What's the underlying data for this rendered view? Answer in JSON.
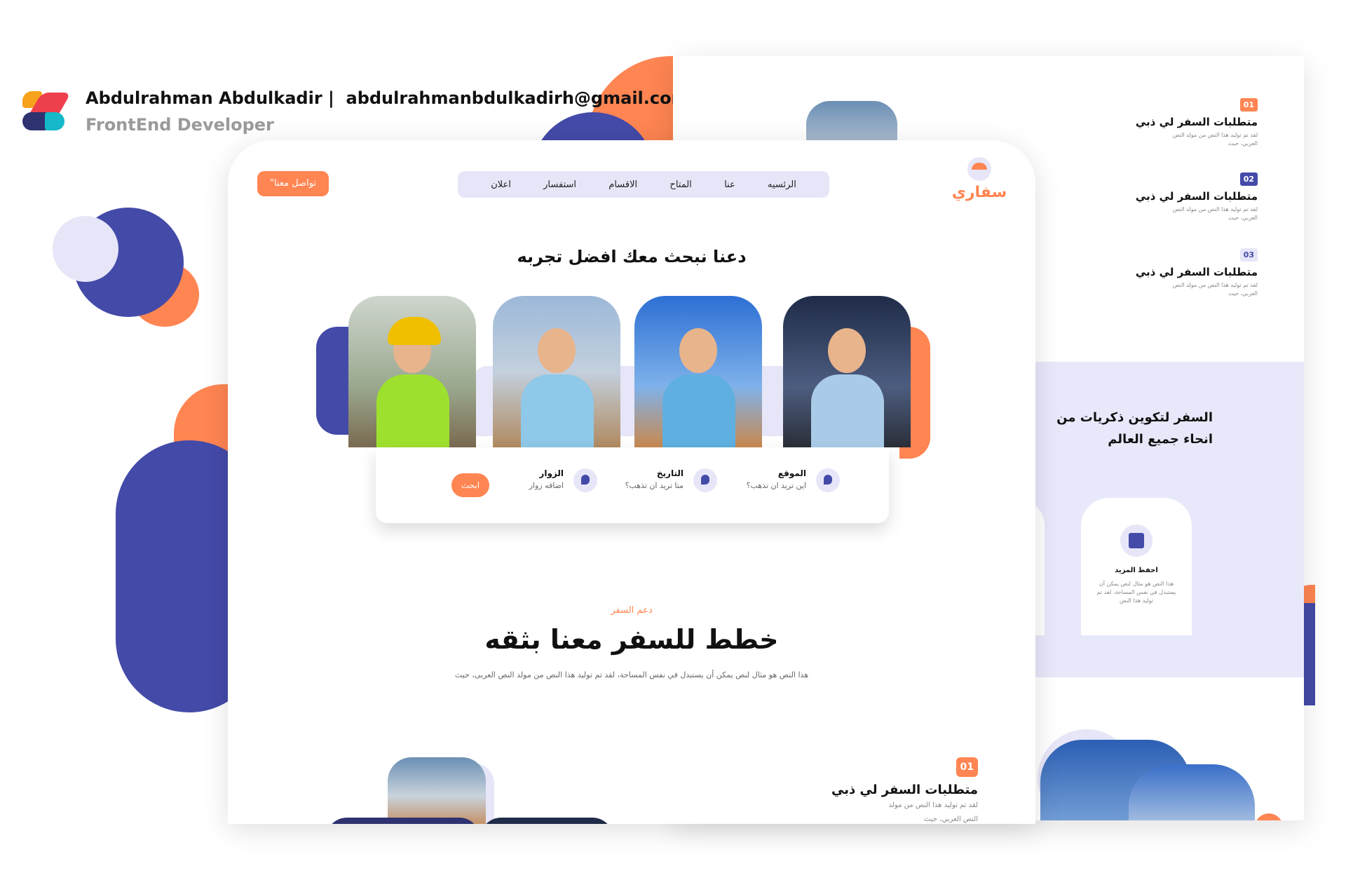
{
  "header": {
    "name": "Abdulrahman Abdulkadir |",
    "email": "abdulrahmanbdulkadirh@gmail.com",
    "role": "FrontEnd Developer"
  },
  "brand": {
    "logo_text": "سفاري"
  },
  "nav": {
    "cta": "تواصل معنا\"",
    "items": [
      "الرئسيه",
      "عنا",
      "المتاح",
      "الاقسام",
      "استفسار",
      "اعلان"
    ]
  },
  "hero": {
    "title": "دعنا نبحث معك افضل تجربه"
  },
  "search": {
    "location_label": "الموقع",
    "location_sub": "اين تريد ان تذهب؟",
    "date_label": "التاريخ",
    "date_sub": "متا تريد ان تذهب؟",
    "visitors_label": "الزوار",
    "visitors_sub": "اضافه زوار",
    "button": "ابحث"
  },
  "section": {
    "tag": "دعم السفر",
    "title": "خطط للسفر معنا بثقه",
    "lead": "هذا النص هو مثال لنص يمكن أن يستبدل في نفس المساحة، لقد تم توليد هذا النص من مولد النص العربى، حيث"
  },
  "front_feature": {
    "badge": "01",
    "title": "متطلبات السفر لي ذبي",
    "desc1": "لقد تم توليد هذا النص من مولد",
    "desc2": "النص العربي، حيث"
  },
  "back": {
    "features": [
      {
        "badge": "01",
        "title": "متطلبات السفر لي ذبي",
        "desc": "لقد تم توليد هذا النص من مولد النص العربي، حيث"
      },
      {
        "badge": "02",
        "title": "متطلبات السفر لي ذبي",
        "desc": "لقد تم توليد هذا النص من مولد النص العربي، حيث"
      },
      {
        "badge": "03",
        "title": "متطلبات السفر لي ذبي",
        "desc": "لقد تم توليد هذا النص من مولد النص العربي، حيث"
      }
    ],
    "heading_line1": "السفر لتكوين ذكريات من",
    "heading_line2": "انحاء جميع العالم",
    "save_title": "احفظ المزيد",
    "save_desc": "هذا النص هو مثال لنص يمكن أن يستبدل في نفس المساحة، لقد تم توليد هذا النص"
  },
  "colors": {
    "accent": "#ff8552",
    "primary": "#444aa8",
    "lavender": "#e6e6f8"
  }
}
